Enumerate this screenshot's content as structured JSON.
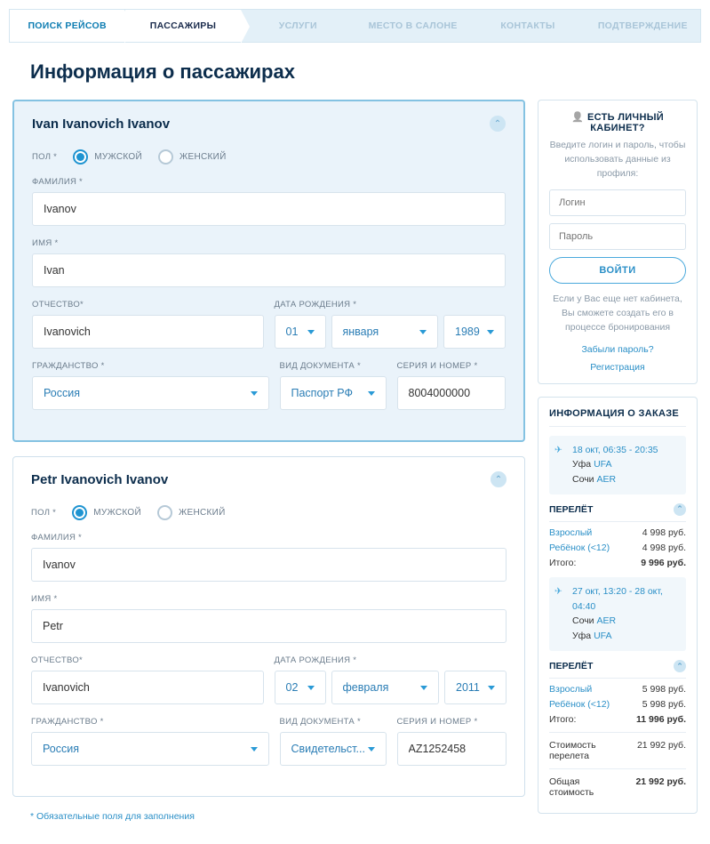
{
  "tabs": [
    "ПОИСК РЕЙСОВ",
    "ПАССАЖИРЫ",
    "УСЛУГИ",
    "МЕСТО В САЛОНЕ",
    "КОНТАКТЫ",
    "ПОДТВЕРЖДЕНИЕ"
  ],
  "page_title": "Информация о пассажирах",
  "labels": {
    "gender": "ПОЛ *",
    "male": "МУЖСКОЙ",
    "female": "ЖЕНСКИЙ",
    "surname": "ФАМИЛИЯ *",
    "name": "ИМЯ *",
    "patronymic": "ОТЧЕСТВО*",
    "dob": "ДАТА РОЖДЕНИЯ *",
    "citizenship": "ГРАЖДАНСТВО *",
    "doc_type": "ВИД ДОКУМЕНТА *",
    "doc_num": "СЕРИЯ И НОМЕР *"
  },
  "passengers": [
    {
      "title": "Ivan Ivanovich Ivanov",
      "gender": "male",
      "surname": "Ivanov",
      "name": "Ivan",
      "patronymic": "Ivanovich",
      "dob_day": "01",
      "dob_month": "января",
      "dob_year": "1989",
      "citizenship": "Россия",
      "doc_type": "Паспорт РФ",
      "doc_num": "8004000000"
    },
    {
      "title": "Petr Ivanovich Ivanov",
      "gender": "male",
      "surname": "Ivanov",
      "name": "Petr",
      "patronymic": "Ivanovich",
      "dob_day": "02",
      "dob_month": "февраля",
      "dob_year": "2011",
      "citizenship": "Россия",
      "doc_type": "Свидетельст...",
      "doc_num": "AZ1252458"
    }
  ],
  "footnote": "* Обязательные поля для заполнения",
  "login_panel": {
    "title": "ЕСТЬ ЛИЧНЫЙ КАБИНЕТ?",
    "subtitle": "Введите логин и пароль, чтобы использовать данные из профиля:",
    "login_ph": "Логин",
    "pass_ph": "Пароль",
    "login_btn": "ВОЙТИ",
    "no_account": "Если у Вас еще нет кабинета, Вы сможете создать его в процессе бронирования",
    "forgot": "Забыли пароль?",
    "register": "Регистрация"
  },
  "order": {
    "title": "ИНФОРМАЦИЯ О ЗАКАЗЕ",
    "segments": [
      {
        "time": "18 окт, 06:35 - 20:35",
        "from_city": "Уфа",
        "from_code": "UFA",
        "to_city": "Сочи",
        "to_code": "AER"
      },
      {
        "time": "27 окт, 13:20 - 28 окт, 04:40",
        "from_city": "Сочи",
        "from_code": "AER",
        "to_city": "Уфа",
        "to_code": "UFA"
      }
    ],
    "fare_label": "ПЕРЕЛЁТ",
    "fares": [
      {
        "lines": [
          {
            "l": "Взрослый",
            "r": "4 998 руб."
          },
          {
            "l": "Ребёнок (<12)",
            "r": "4 998 руб."
          }
        ],
        "total_l": "Итого:",
        "total_r": "9 996 руб."
      },
      {
        "lines": [
          {
            "l": "Взрослый",
            "r": "5 998 руб."
          },
          {
            "l": "Ребёнок (<12)",
            "r": "5 998 руб."
          }
        ],
        "total_l": "Итого:",
        "total_r": "11 996 руб."
      }
    ],
    "summary": [
      {
        "l": "Стоимость перелета",
        "r": "21 992 руб."
      },
      {
        "l": "Общая стоимость",
        "r": "21 992 руб."
      }
    ]
  }
}
